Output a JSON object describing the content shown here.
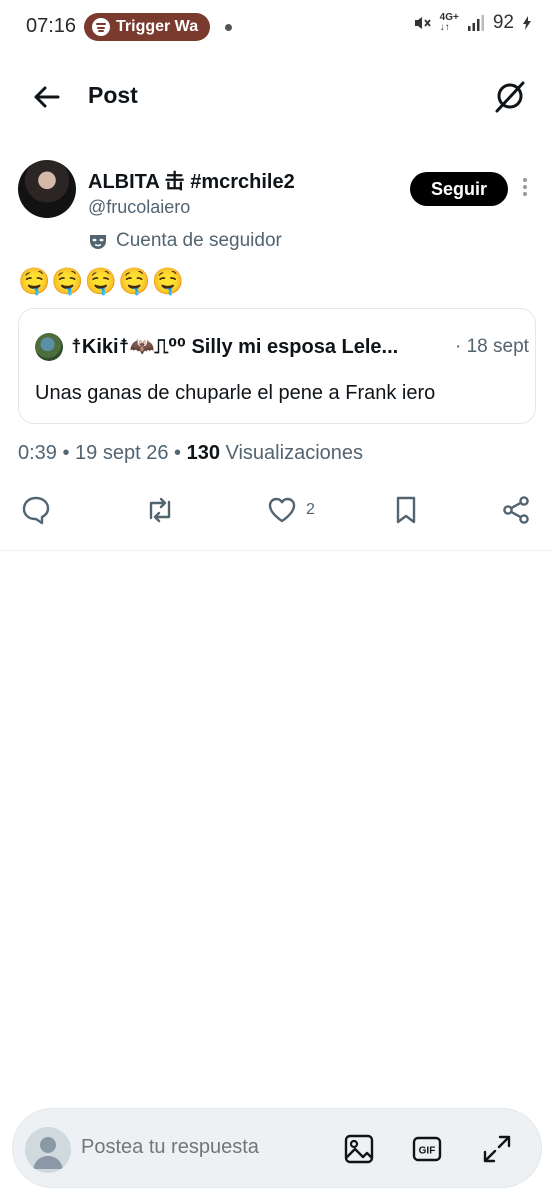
{
  "status_bar": {
    "time": "07:16",
    "media_pill": "Trigger Wa",
    "network_top": "4G+",
    "network_bottom": "↓↑",
    "battery": "92"
  },
  "header": {
    "title": "Post"
  },
  "post": {
    "author_name": "ALBITA 击 #mcrchile2",
    "author_handle": "@frucolaiero",
    "follow_label": "Seguir",
    "account_label": "Cuenta de seguidor",
    "text": "🤤🤤🤤🤤🤤",
    "quoted": {
      "author": "☨Kiki☨🦇⎍⁰⁰ Silly mi esposa Lele...",
      "date": "· 18 sept",
      "text": "Unas ganas de chuparle el pene a Frank iero"
    },
    "meta": {
      "time_date": "0:39 • 19 sept 26 • ",
      "views_count": "130",
      "views_label": " Visualizaciones"
    },
    "actions": {
      "likes": "2"
    }
  },
  "reply_bar": {
    "placeholder": "Postea tu respuesta"
  },
  "colors": {
    "muted": "#536471",
    "text": "#0f1419",
    "pill": "#7a3b2e"
  }
}
